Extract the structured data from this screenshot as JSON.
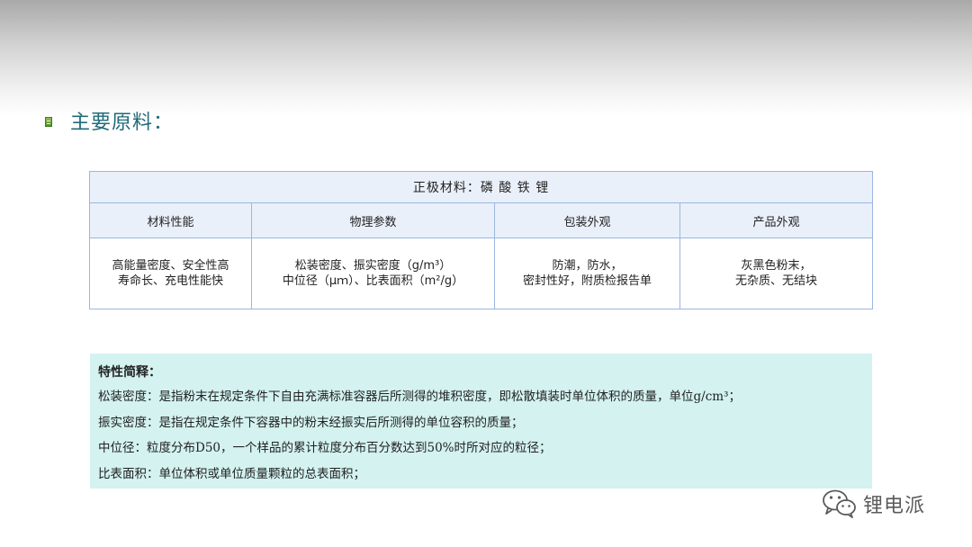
{
  "slide": {
    "heading": "主要原料："
  },
  "table": {
    "title": "正极材料：磷 酸 铁 锂",
    "columns": [
      "材料性能",
      "物理参数",
      "包装外观",
      "产品外观"
    ],
    "row": [
      [
        "高能量密度、安全性高",
        "寿命长、充电性能快"
      ],
      [
        "松装密度、振实密度（g/m³）",
        "中位径（μｍ）、比表面积（m²/g）"
      ],
      [
        "防潮，防水，",
        "密封性好，附质检报告单"
      ],
      [
        "灰黑色粉末，",
        "无杂质、无结块"
      ]
    ]
  },
  "notes": {
    "title": "特性简释：",
    "lines": [
      "松装密度：是指粉末在规定条件下自由充满标准容器后所测得的堆积密度，即松散填装时单位体积的质量，单位g/cm³；",
      "振实密度：是指在规定条件下容器中的粉末经振实后所测得的单位容积的质量；",
      "中位径：粒度分布D50，一个样品的累计粒度分布百分数达到50%时所对应的粒径；",
      "比表面积：单位体积或单位质量颗粒的总表面积；"
    ]
  },
  "watermark": {
    "text": "锂电派",
    "icon": "wechat-icon"
  },
  "colors": {
    "heading": "#1f6b7a",
    "table_border": "#9bb7e0",
    "table_header_bg": "#eaf0fa",
    "notes_bg": "#d3f2f0",
    "bullet": "#5a9a30"
  }
}
